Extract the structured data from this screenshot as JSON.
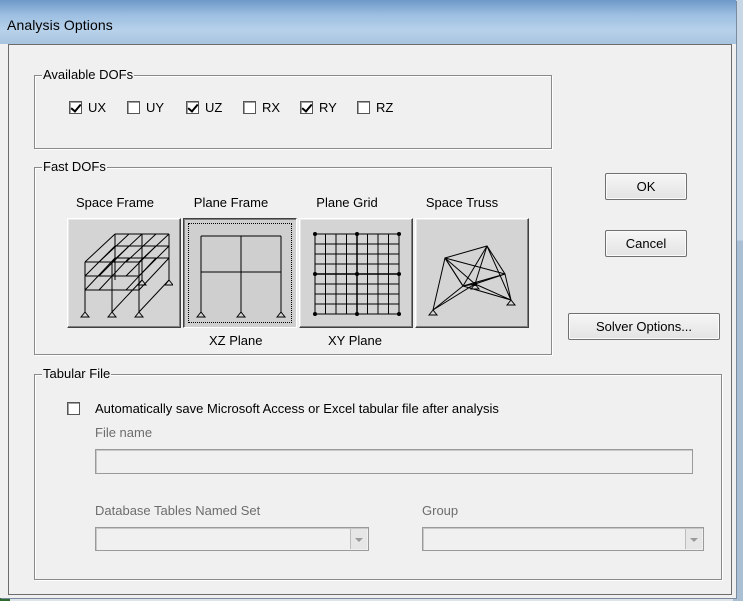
{
  "window": {
    "title": "Analysis Options"
  },
  "available_dofs": {
    "legend": "Available DOFs",
    "items": [
      {
        "label": "UX",
        "checked": true
      },
      {
        "label": "UY",
        "checked": false
      },
      {
        "label": "UZ",
        "checked": true
      },
      {
        "label": "RX",
        "checked": false
      },
      {
        "label": "RY",
        "checked": true
      },
      {
        "label": "RZ",
        "checked": false
      }
    ]
  },
  "fast_dofs": {
    "legend": "Fast DOFs",
    "options": [
      {
        "label": "Space Frame",
        "icon": "space-frame-icon",
        "selected": false
      },
      {
        "label": "Plane Frame",
        "icon": "plane-frame-icon",
        "selected": true
      },
      {
        "label": "Plane Grid",
        "icon": "plane-grid-icon",
        "selected": false
      },
      {
        "label": "Space Truss",
        "icon": "space-truss-icon",
        "selected": false
      }
    ],
    "plane_labels": [
      "XZ Plane",
      "XY Plane"
    ]
  },
  "buttons": {
    "ok": "OK",
    "cancel": "Cancel",
    "solver_options": "Solver Options..."
  },
  "tabular_file": {
    "legend": "Tabular File",
    "auto_save_label": "Automatically save Microsoft Access or Excel tabular file after analysis",
    "auto_save_checked": false,
    "file_name_label": "File name",
    "file_name_value": "",
    "db_tables_label": "Database Tables Named Set",
    "db_tables_value": "",
    "group_label": "Group",
    "group_value": ""
  }
}
